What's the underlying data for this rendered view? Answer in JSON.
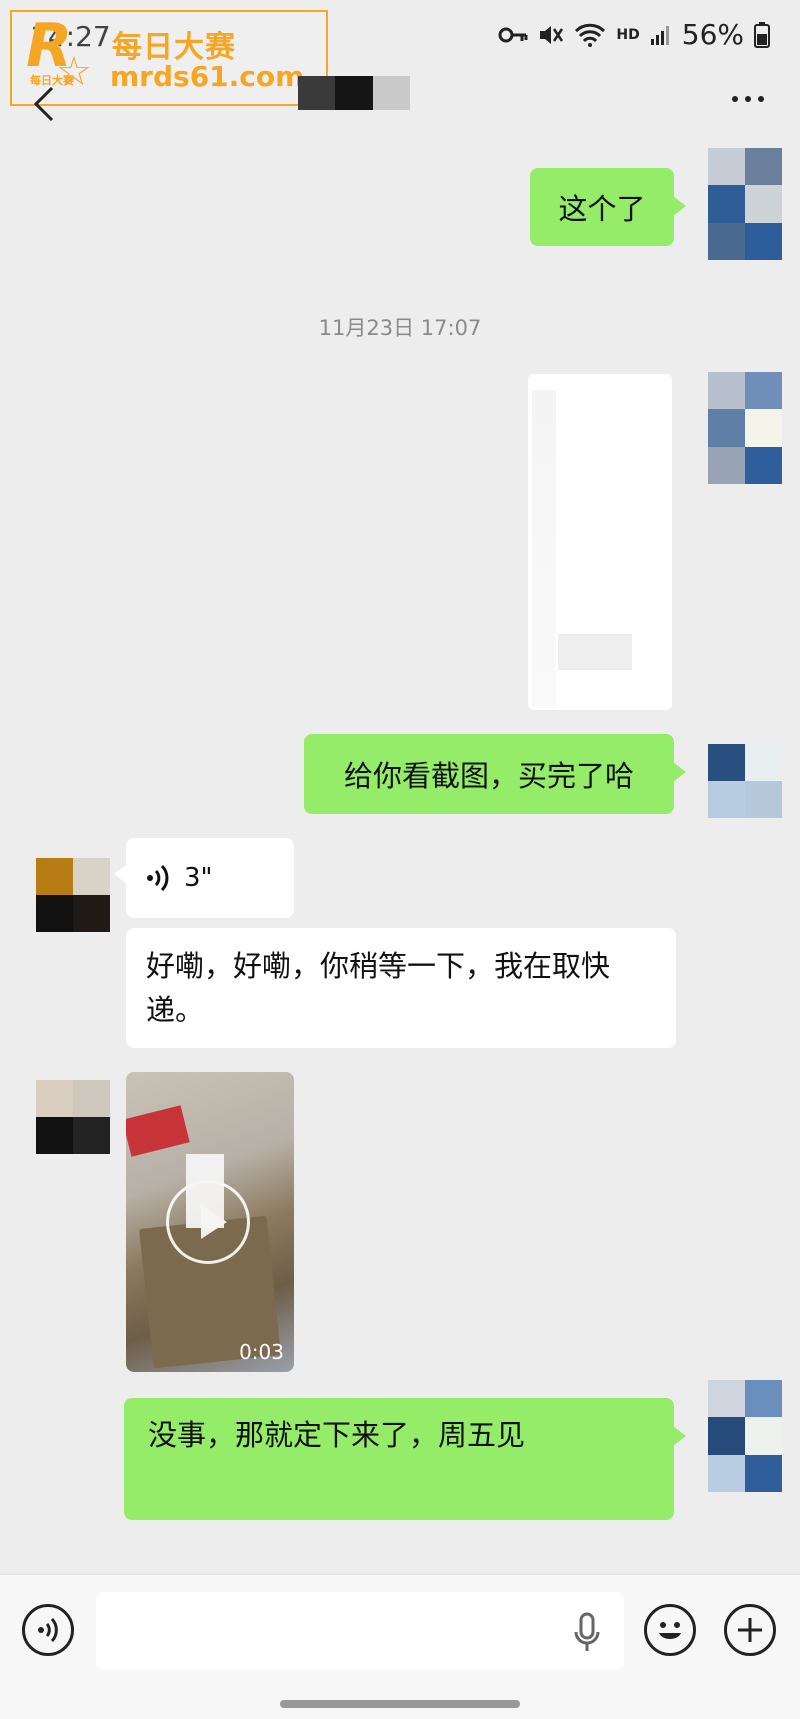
{
  "status_bar": {
    "time": "14:27",
    "network": "HD",
    "battery": "56%"
  },
  "watermark": {
    "logo_letter": "R",
    "logo_sub": "每日大赛",
    "title": "每日大赛",
    "url": "mrds61.com"
  },
  "header": {
    "contact_name": ""
  },
  "messages": {
    "out_1": "这个了",
    "timestamp": "11月23日 17:07",
    "out_2": "给你看截图，买完了哈",
    "voice_duration": "3\"",
    "in_1": "好嘞，好嘞，你稍等一下，我在取快递。",
    "video_duration": "0:03",
    "out_3": "没事，那就定下来了，周五见"
  },
  "input": {
    "value": "",
    "placeholder": ""
  },
  "colors": {
    "outgoing_bubble": "#95ec69",
    "incoming_bubble": "#ffffff",
    "background": "#ededed"
  },
  "icons": [
    "back-icon",
    "more-icon",
    "voice-wave-icon",
    "play-icon",
    "voice-toggle-icon",
    "mic-icon",
    "emoji-icon",
    "plus-icon",
    "wifi-icon",
    "mute-icon",
    "key-icon",
    "signal-icon",
    "battery-icon"
  ]
}
